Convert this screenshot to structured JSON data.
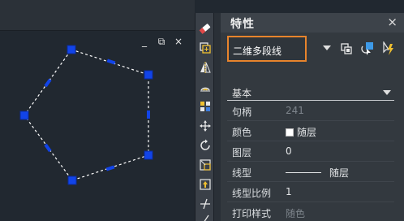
{
  "canvas": {
    "controls": {
      "minimize": "_",
      "restore": "⧉",
      "close": "×"
    },
    "polygon": {
      "line_color": "#ffffff",
      "grip_color": "#1244e8"
    }
  },
  "toolbar": {
    "tools": [
      "eraser-icon",
      "copy-icon",
      "mirror-icon",
      "offset-icon",
      "array-icon",
      "move-icon",
      "rotate-icon",
      "scale-icon",
      "stretch-icon",
      "trim-icon",
      "extend-icon"
    ]
  },
  "properties": {
    "title": "特性",
    "close": "×",
    "object_type": "二维多段线",
    "section": "基本",
    "rows": [
      {
        "name": "句柄",
        "value": "241",
        "dim": true
      },
      {
        "name": "颜色",
        "value": "随层",
        "swatch": "#ffffff"
      },
      {
        "name": "图层",
        "value": "0"
      },
      {
        "name": "线型",
        "value": "随层",
        "line": true
      },
      {
        "name": "线型比例",
        "value": "1"
      },
      {
        "name": "打印样式",
        "value": "随色",
        "dim": true
      }
    ]
  },
  "colors": {
    "accent": "#e8842c",
    "grip": "#1244e8"
  }
}
